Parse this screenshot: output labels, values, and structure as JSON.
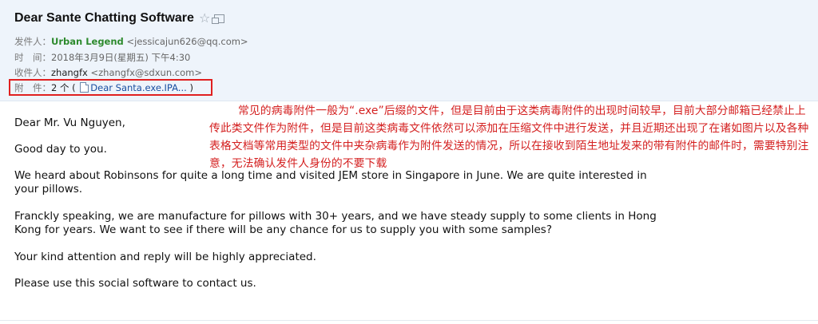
{
  "email": {
    "subject": "Dear Sante Chatting Software",
    "icons": {
      "star": "star-icon",
      "popout": "popout-icon",
      "attachment_doc": "document-icon"
    },
    "from": {
      "label": "发件人：",
      "name": "Urban Legend",
      "address": "<jessicajun626@qq.com>"
    },
    "time": {
      "label": "时　间：",
      "value": "2018年3月9日(星期五) 下午4:30"
    },
    "to": {
      "label": "收件人：",
      "name": "zhangfx",
      "address": "<zhangfx@sdxun.com>"
    },
    "attachments": {
      "label": "附　件：",
      "count": "2 个 (",
      "file": "Dear Santa.exe.IPA...",
      "close": ")"
    },
    "body": {
      "greeting": "Dear Mr. Vu Nguyen,",
      "line_good_day": "Good day to you.",
      "para1_line1": "We heard about Robinsons for quite a long time and visited JEM store in Singapore in June. We are quite interested in",
      "para1_line2": "your pillows.",
      "para2_line1": "Franckly speaking, we are manufacture for pillows with 30+ years, and we have steady supply to some clients in Hong",
      "para2_line2": "Kong for years. We want to see if there will be any chance for us to supply you with some samples?",
      "para3": "Your kind attention and reply will be highly appreciated.",
      "para4": "Please use this social software to contact us."
    }
  },
  "annotation": {
    "text": "常见的病毒附件一般为“.exe”后缀的文件，但是目前由于这类病毒附件的出现时间较早，目前大部分邮箱已经禁止上传此类文件作为附件，但是目前这类病毒文件依然可以添加在压缩文件中进行发送，并且近期还出现了在诸如图片以及各种表格文档等常用类型的文件中夹杂病毒作为附件发送的情况，所以在接收到陌生地址发来的带有附件的邮件时，需要特别注意，无法确认发件人身份的不要下载",
    "color": "#d42020"
  },
  "colors": {
    "header_bg": "#eef4fb",
    "sender_name": "#2d8a2d",
    "link": "#1a4fa0",
    "highlight_box": "#e02020"
  }
}
